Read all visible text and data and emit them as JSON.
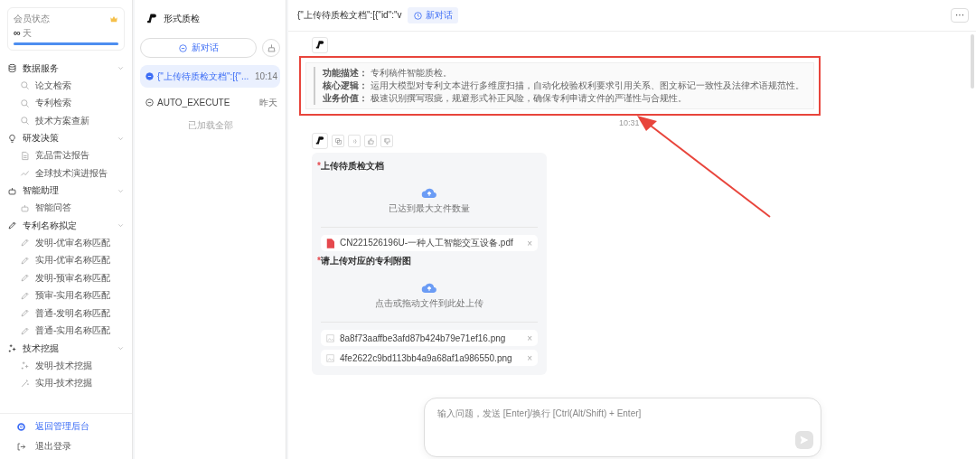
{
  "membership": {
    "label": "会员状态",
    "value": "∞",
    "unit": "天",
    "level": 1
  },
  "nav_groups": [
    {
      "title": "数据服务",
      "expanded": true,
      "items": [
        {
          "label": "论文检索"
        },
        {
          "label": "专利检索"
        },
        {
          "label": "技术方案查新"
        }
      ]
    },
    {
      "title": "研发决策",
      "expanded": true,
      "items": [
        {
          "label": "竞品雷达报告"
        },
        {
          "label": "全球技术演进报告"
        }
      ]
    },
    {
      "title": "智能助理",
      "expanded": true,
      "items": [
        {
          "label": "智能问答"
        }
      ]
    },
    {
      "title": "专利名称拟定",
      "expanded": true,
      "items": [
        {
          "label": "发明-优审名称匹配"
        },
        {
          "label": "实用-优审名称匹配"
        },
        {
          "label": "发明-预审名称匹配"
        },
        {
          "label": "预审-实用名称匹配"
        },
        {
          "label": "普通-发明名称匹配"
        },
        {
          "label": "普通-实用名称匹配"
        }
      ]
    },
    {
      "title": "技术挖掘",
      "expanded": true,
      "items": [
        {
          "label": "发明-技术挖掘"
        },
        {
          "label": "实用-技术挖掘"
        }
      ]
    }
  ],
  "sidebar_footer": [
    {
      "label": "返回管理后台",
      "kind": "admin"
    },
    {
      "label": "退出登录",
      "kind": "logout"
    }
  ],
  "app": {
    "title": "形式质检",
    "new_chat": "新对话"
  },
  "conversations": [
    {
      "title": "{\"上传待质检文档\":[{\"...",
      "time": "10:14",
      "selected": true
    },
    {
      "title": "AUTO_EXECUTE",
      "time": "昨天",
      "selected": false
    }
  ],
  "list_end": "已加载全部",
  "chat_header": {
    "title": "{\"上传待质检文档\":[{\"id\":\"v",
    "tag": "新对话",
    "more": "···"
  },
  "intro": {
    "lines": [
      {
        "label": "功能描述：",
        "text": "专利稿件智能质检。"
      },
      {
        "label": "核心逻辑：",
        "text": "运用大模型对专利文本进行多维度扫描，自动化校验权利要求引用关系、图文标记一致性及法律术语规范性。"
      },
      {
        "label": "业务价值：",
        "text": "极速识别撰写瑕疵，规避形式补正风险，确保专利申请文件的严谨性与合规性。"
      }
    ],
    "time": "10:31"
  },
  "form": {
    "sections": [
      {
        "label": "上传待质检文档",
        "required_mark": "*",
        "upload_text": "已达到最大文件数量",
        "files": [
          {
            "name": "CN221526196U-一种人工智能交互设备.pdf",
            "kind": "pdf",
            "remove": "×"
          }
        ]
      },
      {
        "label": "请上传对应的专利附图",
        "required_mark": "*",
        "upload_text": "点击或拖动文件到此处上传",
        "files": [
          {
            "name": "8a8f73aaffbe3afd87b424b79e71ef16.png",
            "kind": "image",
            "remove": "×"
          },
          {
            "name": "4fe2622c9bd113bb4a9a68af1a986550.png",
            "kind": "image",
            "remove": "×"
          }
        ]
      }
    ]
  },
  "composer": {
    "placeholder": "输入问题，发送 [Enter]/换行 [Ctrl(Alt/Shift) + Enter]"
  }
}
